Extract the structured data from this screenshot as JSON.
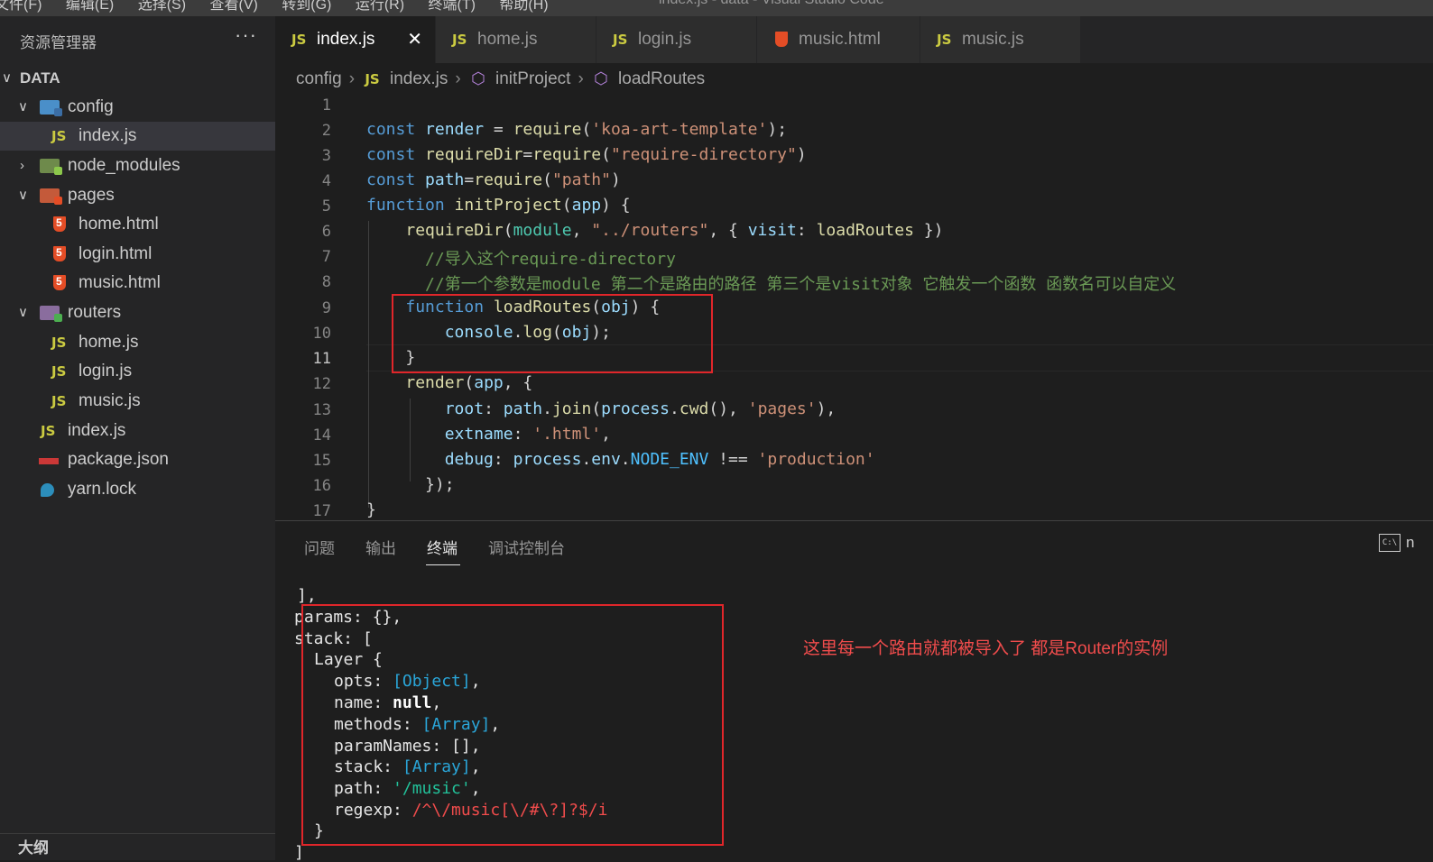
{
  "menubar": {
    "items": [
      "文件(F)",
      "编辑(E)",
      "选择(S)",
      "查看(V)",
      "转到(G)",
      "运行(R)",
      "终端(T)",
      "帮助(H)"
    ],
    "window_title": "index.js - data - Visual Studio Code"
  },
  "explorer": {
    "title": "资源管理器",
    "more": "···",
    "root": "DATA",
    "items": [
      {
        "label": "config",
        "type": "folder"
      },
      {
        "label": "index.js",
        "type": "js"
      },
      {
        "label": "node_modules",
        "type": "folder"
      },
      {
        "label": "pages",
        "type": "folder"
      },
      {
        "label": "home.html",
        "type": "html"
      },
      {
        "label": "login.html",
        "type": "html"
      },
      {
        "label": "music.html",
        "type": "html"
      },
      {
        "label": "routers",
        "type": "folder"
      },
      {
        "label": "home.js",
        "type": "js"
      },
      {
        "label": "login.js",
        "type": "js"
      },
      {
        "label": "music.js",
        "type": "js"
      },
      {
        "label": "index.js",
        "type": "js"
      },
      {
        "label": "package.json",
        "type": "npm"
      },
      {
        "label": "yarn.lock",
        "type": "yarn"
      }
    ],
    "outline": "大纲"
  },
  "tabs": [
    {
      "label": "index.js",
      "icon": "JS"
    },
    {
      "label": "home.js",
      "icon": "JS"
    },
    {
      "label": "login.js",
      "icon": "JS"
    },
    {
      "label": "music.html",
      "icon": "html"
    },
    {
      "label": "music.js",
      "icon": "JS"
    }
  ],
  "close_glyph": "✕",
  "js_badge": "JS",
  "breadcrumb": {
    "folder": "config",
    "file": "index.js",
    "symbol1": "initProject",
    "symbol2": "loadRoutes"
  },
  "code_lines": {
    "numbers": [
      "1",
      "2",
      "3",
      "4",
      "5",
      "6",
      "7",
      "8",
      "9",
      "10",
      "11",
      "12",
      "13",
      "14",
      "15",
      "16",
      "17"
    ],
    "l2": [
      "const",
      "render",
      " = ",
      "require",
      "(",
      "'koa-art-template'",
      ");"
    ],
    "l3": [
      "const",
      "requireDir",
      "=",
      "require",
      "(",
      "\"require-directory\"",
      ")"
    ],
    "l4": [
      "const",
      "path",
      "=",
      "require",
      "(",
      "\"path\"",
      ")"
    ],
    "l5": [
      "function",
      "initProject",
      "(",
      "app",
      ") {"
    ],
    "l6": [
      "requireDir",
      "(",
      "module",
      ", ",
      "\"../routers\"",
      ", { ",
      "visit",
      ": ",
      "loadRoutes",
      " })"
    ],
    "l7": "//导入这个require-directory",
    "l8": "//第一个参数是module 第二个是路由的路径 第三个是visit对象 它触发一个函数 函数名可以自定义",
    "l9": [
      "function",
      "loadRoutes",
      "(",
      "obj",
      ") {"
    ],
    "l10": [
      "console",
      ".",
      "log",
      "(",
      "obj",
      ");"
    ],
    "l11": "}",
    "l12": [
      "render",
      "(",
      "app",
      ", {"
    ],
    "l13": [
      "root",
      ": ",
      "path",
      ".",
      "join",
      "(",
      "process",
      ".",
      "cwd",
      "(), ",
      "'pages'",
      "),"
    ],
    "l14": [
      "extname",
      ": ",
      "'.html'",
      ","
    ],
    "l15": [
      "debug",
      ": ",
      "process",
      ".",
      "env",
      ".",
      "NODE_ENV",
      " !== ",
      "'production'"
    ],
    "l16": "});",
    "l17": "}"
  },
  "panel": {
    "tabs": [
      "问题",
      "输出",
      "终端",
      "调试控制台"
    ],
    "terminal_icon": "C:\\",
    "terminal_name": "n"
  },
  "terminal": {
    "lines": [
      {
        "parts": [
          [
            "],",
            ""
          ]
        ]
      },
      {
        "parts": [
          [
            "params: {},",
            ""
          ]
        ]
      },
      {
        "parts": [
          [
            "stack: [",
            ""
          ]
        ]
      },
      {
        "parts": [
          [
            "Layer {",
            ""
          ]
        ]
      },
      {
        "parts": [
          [
            "opts: ",
            ""
          ],
          [
            "[Object]",
            "tblue"
          ],
          [
            ",",
            ""
          ]
        ]
      },
      {
        "parts": [
          [
            "name: ",
            ""
          ],
          [
            "null",
            "tbold"
          ],
          [
            ",",
            ""
          ]
        ]
      },
      {
        "parts": [
          [
            "methods: ",
            ""
          ],
          [
            "[Array]",
            "tblue"
          ],
          [
            ",",
            ""
          ]
        ]
      },
      {
        "parts": [
          [
            "paramNames: [],",
            ""
          ]
        ]
      },
      {
        "parts": [
          [
            "stack: ",
            ""
          ],
          [
            "[Array]",
            "tblue"
          ],
          [
            ",",
            ""
          ]
        ]
      },
      {
        "parts": [
          [
            "path: ",
            ""
          ],
          [
            "'/music'",
            "tgreen"
          ],
          [
            ",",
            ""
          ]
        ]
      },
      {
        "parts": [
          [
            "regexp: ",
            ""
          ],
          [
            "/^\\/music[\\/#\\?]?$/i",
            "tred"
          ]
        ]
      },
      {
        "parts": [
          [
            "}",
            ""
          ]
        ]
      },
      {
        "parts": [
          [
            "]",
            ""
          ]
        ]
      }
    ]
  },
  "annotation": "这里每一个路由就都被导入了 都是Router的实例"
}
